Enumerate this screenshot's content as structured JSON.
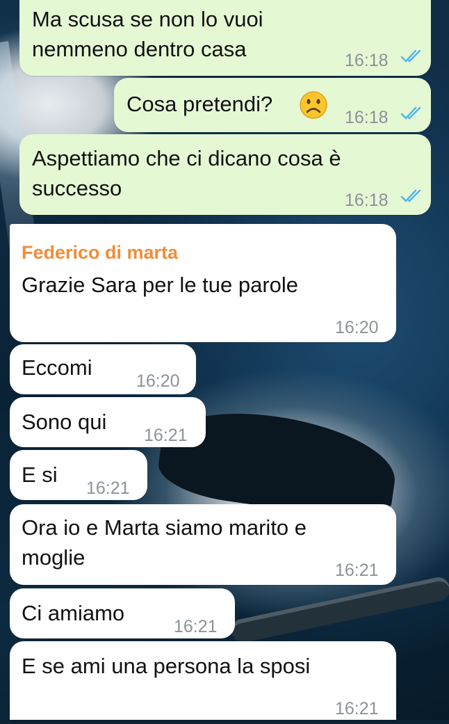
{
  "messages": [
    {
      "direction": "outgoing",
      "lines": [
        "Ma scusa se non lo vuoi",
        "nemmeno dentro casa"
      ],
      "time": "16:18",
      "status": "read-double-check"
    },
    {
      "direction": "outgoing",
      "text": "Cosa pretendi?",
      "emoji": "frowning-face",
      "time": "16:18",
      "status": "read-double-check"
    },
    {
      "direction": "outgoing",
      "lines": [
        "Aspettiamo che ci dicano cosa è",
        "successo"
      ],
      "time": "16:18",
      "status": "read-double-check"
    },
    {
      "direction": "incoming",
      "sender": "Federico di marta",
      "text": "Grazie Sara per le tue parole",
      "time": "16:20"
    },
    {
      "direction": "incoming",
      "text": "Eccomi",
      "time": "16:20"
    },
    {
      "direction": "incoming",
      "text": "Sono qui",
      "time": "16:21"
    },
    {
      "direction": "incoming",
      "text": "E si",
      "time": "16:21"
    },
    {
      "direction": "incoming",
      "lines": [
        "Ora io e Marta siamo marito e",
        "moglie"
      ],
      "time": "16:21"
    },
    {
      "direction": "incoming",
      "text": "Ci amiamo",
      "time": "16:21"
    },
    {
      "direction": "incoming",
      "text": "E se ami una persona la sposi",
      "time": "16:21"
    }
  ],
  "colors": {
    "outgoing_bubble": "#e5f8d4",
    "incoming_bubble": "#ffffff",
    "sender_name": "#f08d3a",
    "read_ticks": "#4fb6ec",
    "timestamp": "#8b9299"
  }
}
